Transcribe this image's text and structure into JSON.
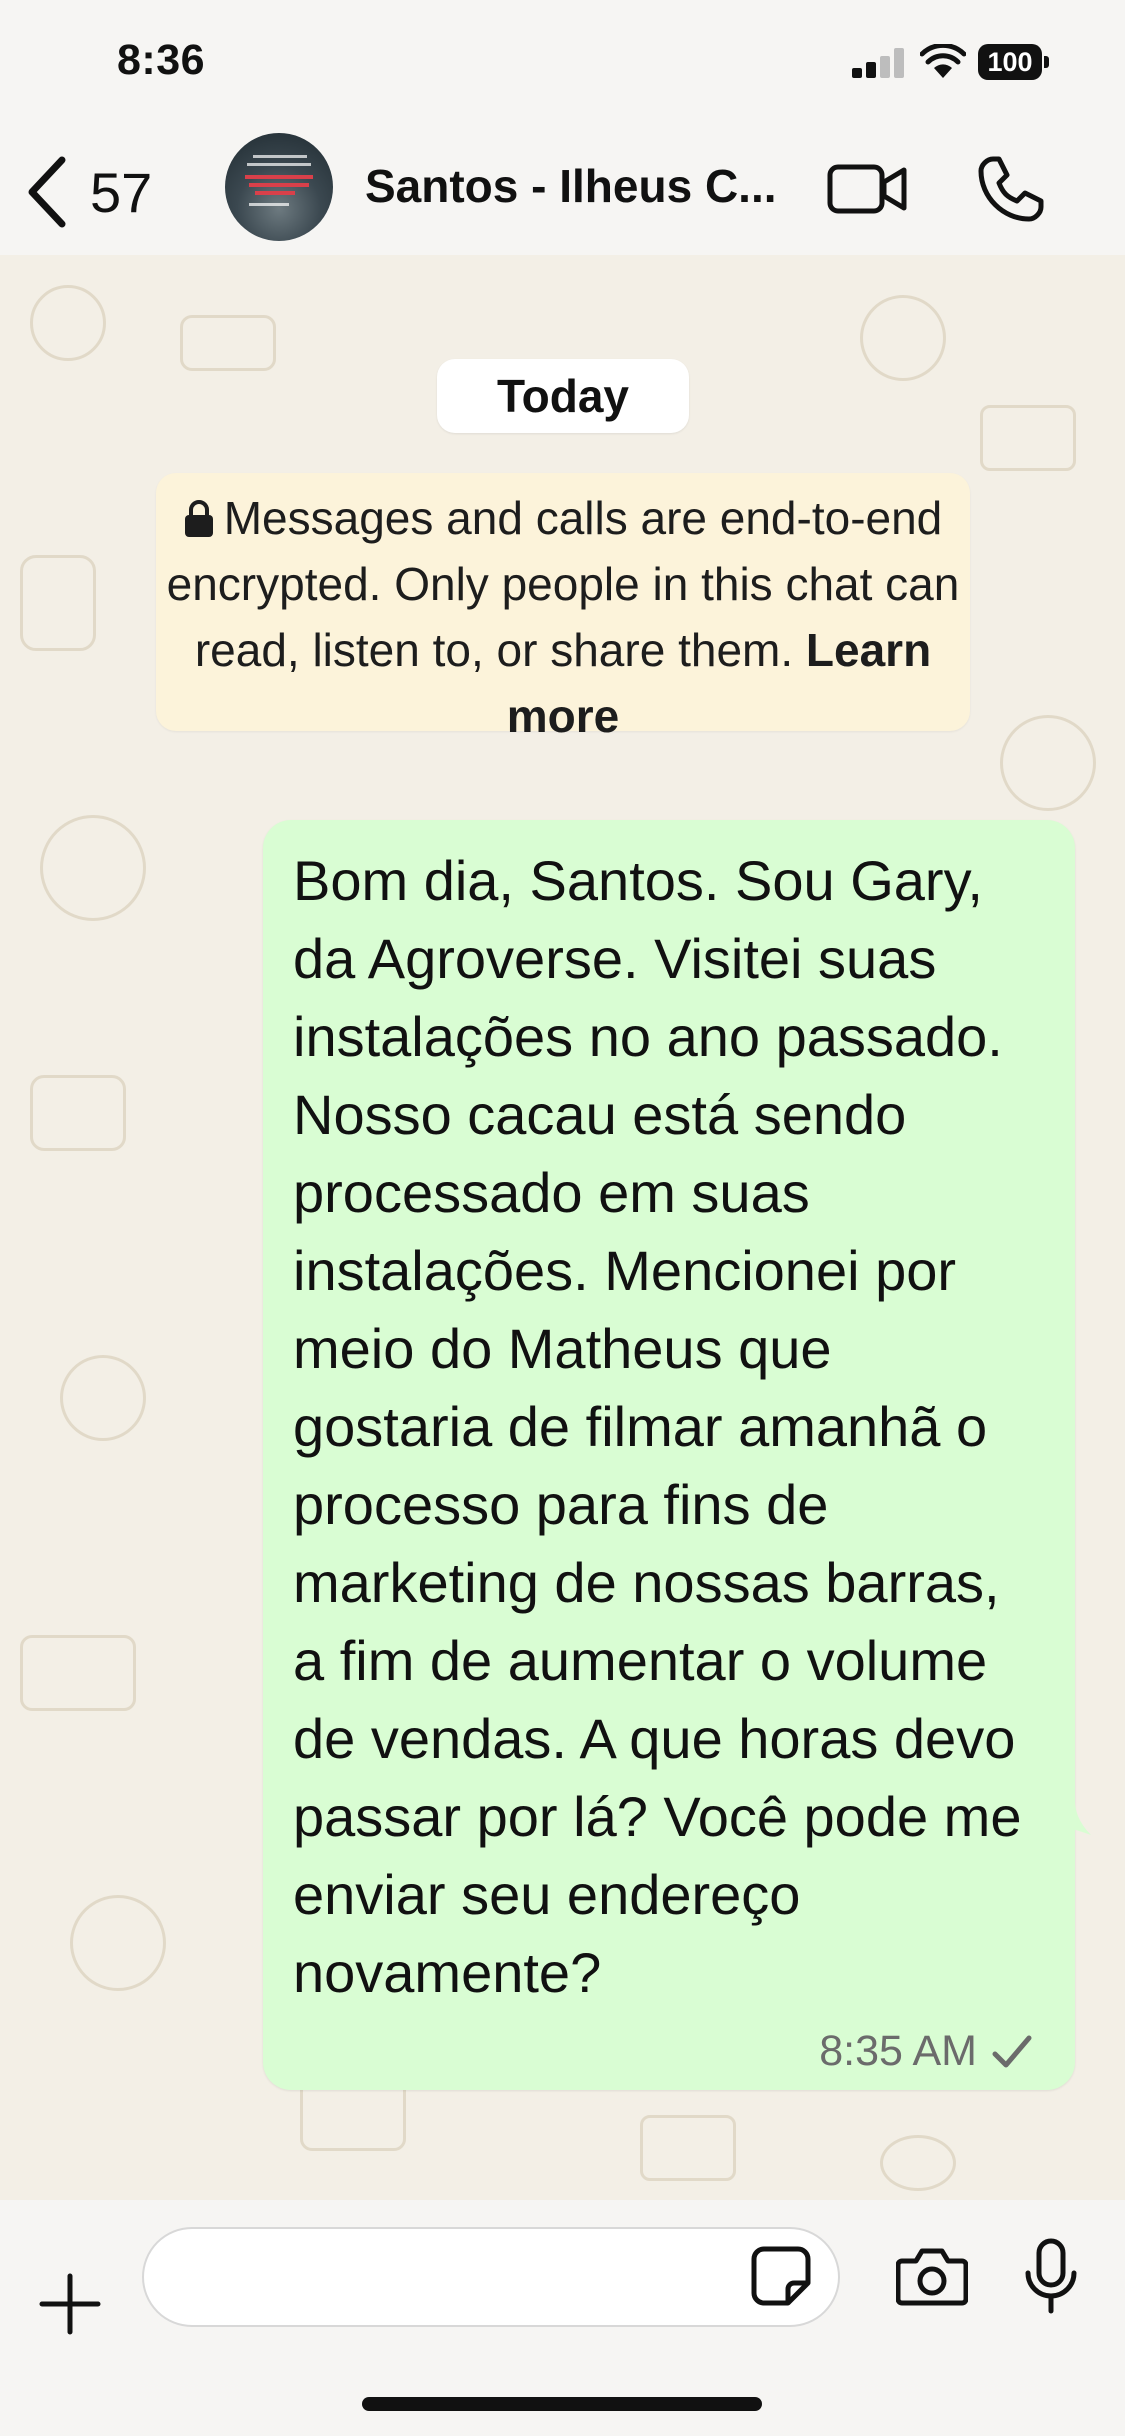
{
  "status_bar": {
    "time": "8:36",
    "battery": "100"
  },
  "header": {
    "back_count": "57",
    "contact_name": "Santos - Ilheus C..."
  },
  "chat": {
    "date_chip": "Today",
    "encryption_notice": {
      "text": "Messages and calls are end-to-end encrypted. Only people in this chat can read, listen to, or share them.",
      "link": "Learn more"
    },
    "messages": [
      {
        "direction": "outgoing",
        "text": "Bom dia, Santos. Sou Gary, da Agroverse. Visitei suas instalações no ano passado. Nosso cacau está sendo processado em suas instalações. Mencionei por meio do Matheus que gostaria de filmar amanhã o processo para fins de marketing de nossas barras, a fim de aumentar o volume de vendas. A que horas devo passar por lá? Você pode me enviar seu endereço novamente?",
        "time": "8:35 AM",
        "status": "sent-check-icon"
      }
    ]
  },
  "input_bar": {
    "placeholder": ""
  },
  "colors": {
    "outgoing_bubble": "#d9fdd3",
    "notice_bg": "#fcf3da",
    "chat_bg": "#f3efe6",
    "bars_bg": "#f6f5f3"
  }
}
